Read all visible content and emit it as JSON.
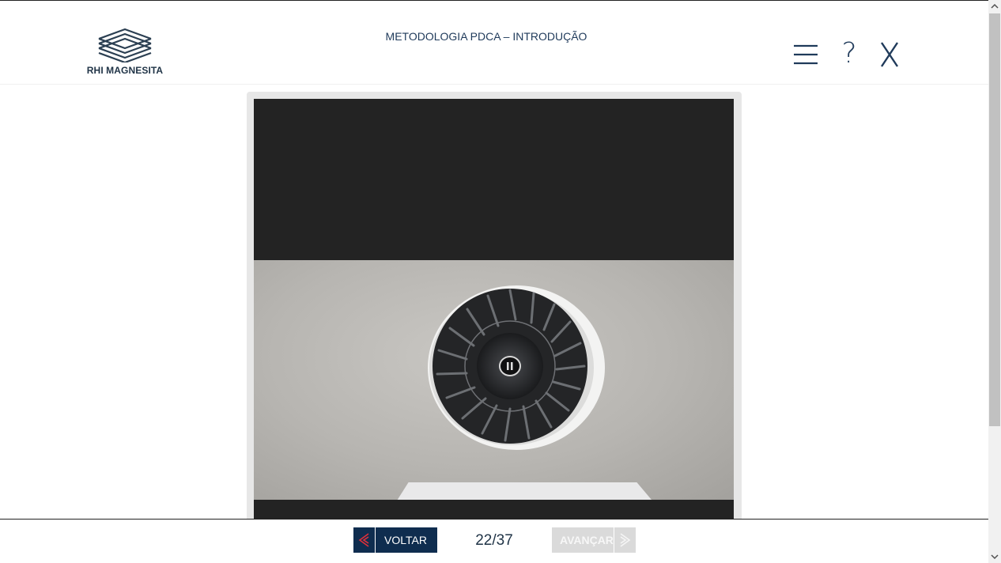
{
  "header": {
    "logo_text": "RHI MAGNESITA",
    "course_title": "METODOLOGIA PDCA – INTRODUÇÃO",
    "menu_icon": "hamburger-menu-icon",
    "help_label": "?",
    "close_icon": "close-x-icon"
  },
  "colors": {
    "brand_navy": "#0f2d4f",
    "accent_red": "#e0303a",
    "disabled_gray": "#dadada"
  },
  "footer": {
    "back_label": "VOLTAR",
    "back_icon": "double-chevron-left-icon",
    "page_counter": "22/37",
    "next_label": "AVANÇAR",
    "next_icon": "double-chevron-right-icon"
  }
}
